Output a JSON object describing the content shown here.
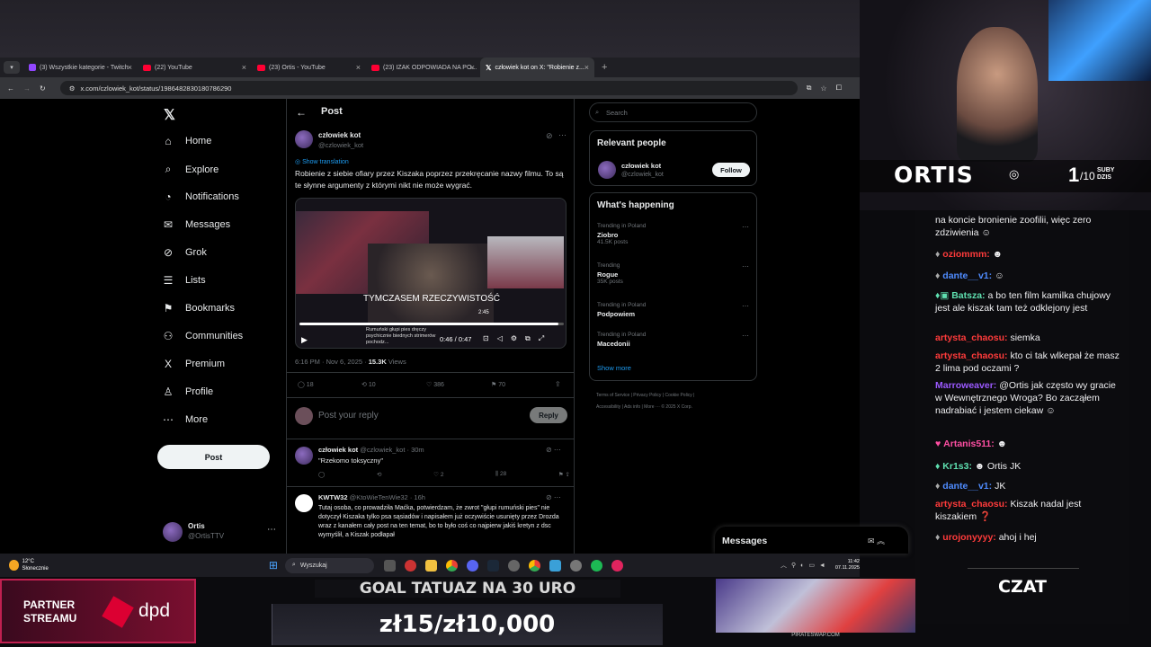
{
  "tabs": [
    {
      "label": "(3) Wszystkie kategorie - Twitch",
      "icon": "twitch-icon"
    },
    {
      "label": "(22) YouTube",
      "icon": "youtube-icon"
    },
    {
      "label": "(23) Ortis - YouTube",
      "icon": "youtube-icon"
    },
    {
      "label": "(23) IZAK ODPOWIADA NA PO...",
      "icon": "youtube-icon"
    },
    {
      "label": "człowiek kot on X: \"Robienie z...",
      "icon": "x-icon"
    }
  ],
  "address": {
    "url": "x.com/czlowiek_kot/status/1986482830180786290"
  },
  "nav": {
    "items": [
      {
        "label": "Home",
        "icon": "⌂"
      },
      {
        "label": "Explore",
        "icon": "⌕"
      },
      {
        "label": "Notifications",
        "icon": "◔"
      },
      {
        "label": "Messages",
        "icon": "✉"
      },
      {
        "label": "Grok",
        "icon": "⊘"
      },
      {
        "label": "Lists",
        "icon": "☰"
      },
      {
        "label": "Bookmarks",
        "icon": "⚑"
      },
      {
        "label": "Communities",
        "icon": "⚇"
      },
      {
        "label": "Premium",
        "icon": "X"
      },
      {
        "label": "Profile",
        "icon": "♙"
      },
      {
        "label": "More",
        "icon": "⋯"
      }
    ],
    "post_button": "Post",
    "account_name": "Ortis",
    "account_handle": "@OrtisTTV"
  },
  "header": {
    "title": "Post"
  },
  "post": {
    "author": "człowiek kot",
    "handle": "@czlowiek_kot",
    "show_translation": "Show translation",
    "text": "Robienie z siebie ofiary przez Kiszaka poprzez przekręcanie nazwy filmu. To są te słynne argumenty z którymi nikt nie może wygrać.",
    "video_caption": "TYMCZASEM RZECZYWISTOŚĆ",
    "video_time": "0:46 / 0:47",
    "video_hover_time": "2:45",
    "video_subtitle": "Rumuński głupi pies dręczy psychicznie biednych strimerów pochodz...",
    "timestamp": "6:16 PM · Nov 6, 2025 ·",
    "views_count": "15.3K",
    "views_label": "Views",
    "replies": "18",
    "reposts": "10",
    "likes": "386",
    "bookmarks": "70"
  },
  "reply_box": {
    "placeholder": "Post your reply",
    "button": "Reply"
  },
  "replies": [
    {
      "author": "człowiek kot",
      "meta": "@czlowiek_kot · 30m",
      "text": "\"Rzekomo toksyczny\"",
      "likes": "2",
      "views": "28"
    },
    {
      "author": "KWTW32",
      "meta": "@KtoWieTenWie32 · 16h",
      "text": "Tutaj osoba, co prowadziła Maćka, potwierdzam, że zwrot \"głupi rumuński pies\" nie dotyczył Kiszaka tylko psa sąsiadów i napisałem już oczywiście usunięty przez Drozda wraz z kanałem cały post na ten temat, bo to było coś co najpierw jakiś kretyn z dsc wymyślił, a Kiszak podłapał"
    }
  ],
  "sidebar": {
    "search_placeholder": "Search",
    "relevant_title": "Relevant people",
    "person_name": "człowiek kot",
    "person_handle": "@czlowiek_kot",
    "follow": "Follow",
    "happening_title": "What's happening",
    "trends": [
      {
        "context": "Trending in Poland",
        "name": "Ziobro",
        "count": "41.5K posts"
      },
      {
        "context": "Trending",
        "name": "Rogue",
        "count": "35K posts"
      },
      {
        "context": "Trending in Poland",
        "name": "Podpowiem",
        "count": ""
      },
      {
        "context": "Trending in Poland",
        "name": "Macedonii",
        "count": ""
      }
    ],
    "show_more": "Show more",
    "footer1": "Terms of Service  |  Privacy Policy  |  Cookie Policy  |",
    "footer2": "Accessibility  |  Ads info  |  More ···  © 2025 X Corp.",
    "messages_label": "Messages"
  },
  "taskbar": {
    "weather_temp": "12°C",
    "weather_desc": "Słonecznie",
    "search": "Wyszukaj",
    "time": "11:42",
    "date": "07.11.2025"
  },
  "stream": {
    "streamer": "ORTIS",
    "subs_label": "SUBY DZIS",
    "subs_count": "1",
    "subs_goal": "/10",
    "chat_title": "CZAT",
    "partner": "PARTNER STREAMU",
    "dpd": "dpd",
    "goal_title": "GOAL TATUAZ NA 30 URO",
    "goal_value": "zł15/zł10,000",
    "ad": "PIRATESWAP.COM"
  },
  "chat": [
    {
      "user": "",
      "text": "na koncie bronienie zoofilii, więc zero zdziwienia",
      "color": "#efeff1"
    },
    {
      "user": "oziommm:",
      "text": "",
      "color": "#ff3b3b"
    },
    {
      "user": "dante__v1:",
      "text": "",
      "color": "#4f8cff"
    },
    {
      "user": "Batsza:",
      "text": "a bo ten film kamilka chujowy jest ale kiszak tam też odklejony jest",
      "color": "#5fe0b0"
    },
    {
      "user": "artysta_chaosu:",
      "text": "siemka",
      "color": "#ff3b3b"
    },
    {
      "user": "artysta_chaosu:",
      "text": "kto ci tak wlkepał że masz 2 lima pod oczami ?",
      "color": "#ff3b3b"
    },
    {
      "user": "Marroweaver:",
      "text": "@Ortis jak często wy gracie w Wewnętrznego Wroga? Bo zacząłem nadrabiać i jestem ciekaw",
      "color": "#9b59ff"
    },
    {
      "user": "Artanis511:",
      "text": "",
      "color": "#ff4fa3"
    },
    {
      "user": "Kr1s3:",
      "text": "Ortis JK",
      "color": "#5fe0b0"
    },
    {
      "user": "dante__v1:",
      "text": "JK",
      "color": "#4f8cff"
    },
    {
      "user": "artysta_chaosu:",
      "text": "Kiszak nadal jest kiszakiem ❓",
      "color": "#ff3b3b"
    },
    {
      "user": "urojonyyyy:",
      "text": "ahoj i hej",
      "color": "#ff3b3b"
    }
  ]
}
